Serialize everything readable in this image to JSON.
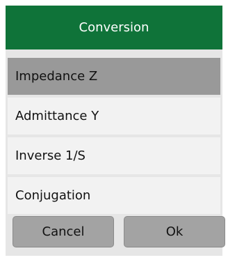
{
  "dialog": {
    "title": "Conversion",
    "options": [
      {
        "label": "Impedance Z",
        "selected": true
      },
      {
        "label": "Admittance Y",
        "selected": false
      },
      {
        "label": "Inverse 1/S",
        "selected": false
      },
      {
        "label": "Conjugation",
        "selected": false
      }
    ],
    "buttons": {
      "cancel": "Cancel",
      "ok": "Ok"
    }
  },
  "colors": {
    "title_bar": "#0f7339",
    "selected_option": "#999999",
    "option_background": "#f2f2f2",
    "button_background": "#a3a3a3",
    "dialog_background": "#e6e6e6"
  }
}
